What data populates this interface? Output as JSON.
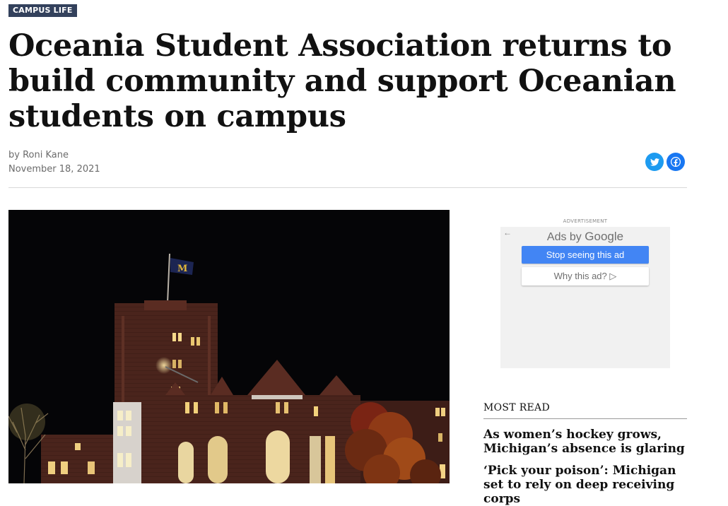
{
  "article": {
    "category": "CAMPUS LIFE",
    "headline": "Oceania Student Association returns to build community and support Oceanian students on campus",
    "byline": "by Roni Kane",
    "date": "November 18, 2021"
  },
  "share": {
    "twitter_icon": "twitter-icon",
    "facebook_icon": "facebook-icon",
    "twitter_color": "#1d9bf0",
    "facebook_color": "#1877f2"
  },
  "advertisement": {
    "label": "ADVERTISEMENT",
    "ads_by_prefix": "Ads by",
    "ads_by_brand": "Google",
    "stop_button": "Stop seeing this ad",
    "why_button": "Why this ad?",
    "why_icon": "▷"
  },
  "most_read": {
    "title": "MOST READ",
    "items": [
      "As women’s hockey grows, Michigan’s absence is glaring",
      "‘Pick your poison’: Michigan set to rely on deep receiving corps"
    ]
  },
  "colors": {
    "category_badge": "#33415c",
    "ad_button": "#4285f4"
  }
}
